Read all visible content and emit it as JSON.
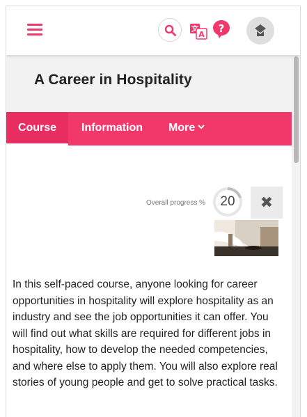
{
  "header": {
    "menu_icon": "hamburger-menu-icon",
    "search_icon": "search-icon",
    "translate_icon": "translate-icon",
    "help_icon": "help-icon",
    "avatar_icon": "user-avatar-icon"
  },
  "course": {
    "title": "A Career in Hospitality"
  },
  "nav": {
    "tabs": [
      {
        "label": "Course"
      },
      {
        "label": "Information"
      },
      {
        "label": "More"
      }
    ]
  },
  "progress": {
    "label": "Overall progress %",
    "value": "20",
    "fraction": 0.2
  },
  "description": "In this self-paced course, anyone looking for career opportunities in hospitality will explore hospitality as an industry and see the job opportunities it can offer. You will find out what skills are required for different jobs in hospitality, how to develop the needed competencies, and where else to apply them. You will also explore real stories of young people and get to solve practical tasks.",
  "colors": {
    "accent": "#f0386b",
    "title_band": "#f2f2f2",
    "progress_ring": "#bfbfbf"
  }
}
